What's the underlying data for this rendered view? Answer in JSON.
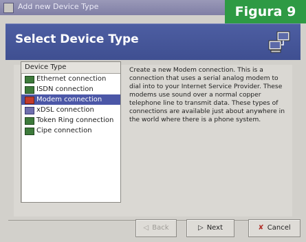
{
  "window": {
    "title": "Add new Device Type"
  },
  "overlay": {
    "label": "Figura 9"
  },
  "header": {
    "title": "Select Device Type"
  },
  "device_list": {
    "column_header": "Device Type",
    "items": [
      {
        "label": "Ethernet connection",
        "icon": "network-card-icon"
      },
      {
        "label": "ISDN connection",
        "icon": "network-card-icon"
      },
      {
        "label": "Modem connection",
        "icon": "modem-icon",
        "selected": true
      },
      {
        "label": "xDSL connection",
        "icon": "xdsl-icon"
      },
      {
        "label": "Token Ring connection",
        "icon": "network-card-icon"
      },
      {
        "label": "Cipe connection",
        "icon": "network-card-icon"
      }
    ]
  },
  "description": "Create a new Modem connection. This is a connection that uses a serial analog modem to dial into to your Internet Service Provider. These modems use sound over a normal copper telephone line to transmit data. These types of connections are available just about anywhere in the world where there is a phone system.",
  "buttons": {
    "back": "Back",
    "next": "Next",
    "cancel": "Cancel"
  },
  "colors": {
    "titlebar": "#8988ad",
    "header": "#4a5a9f",
    "selection": "#4b57a7",
    "figura_badge": "#2e9a44"
  }
}
